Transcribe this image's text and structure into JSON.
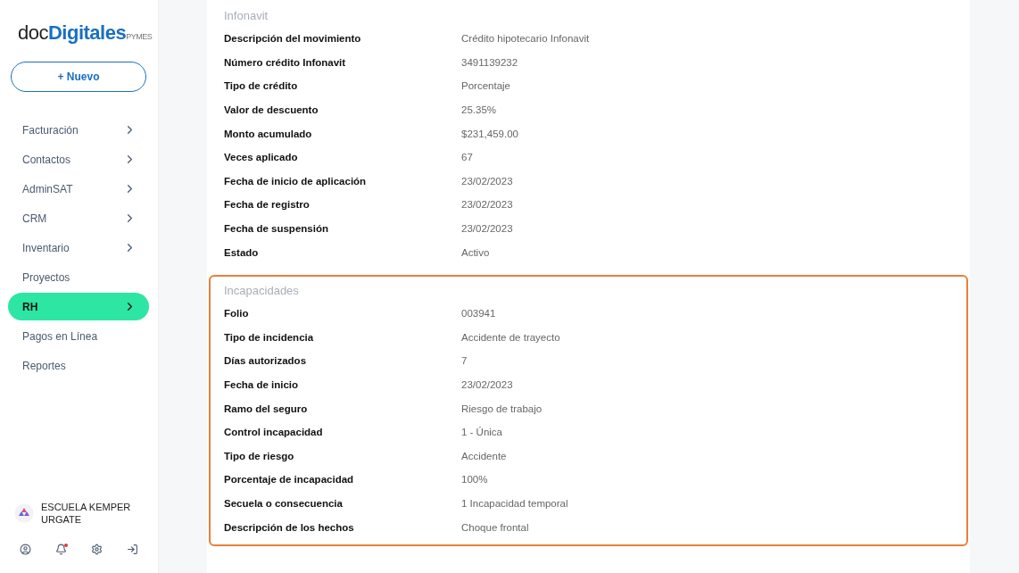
{
  "sidebar": {
    "logo": {
      "main": "doc",
      "accent": "Digitales",
      "suffix": "PYMES"
    },
    "new_button": "+ Nuevo",
    "items": [
      {
        "label": "Facturación",
        "has_children": true,
        "selected": false
      },
      {
        "label": "Contactos",
        "has_children": true,
        "selected": false
      },
      {
        "label": "AdminSAT",
        "has_children": true,
        "selected": false
      },
      {
        "label": "CRM",
        "has_children": true,
        "selected": false
      },
      {
        "label": "Inventario",
        "has_children": true,
        "selected": false
      },
      {
        "label": "Proyectos",
        "has_children": false,
        "selected": false
      },
      {
        "label": "RH",
        "has_children": true,
        "selected": true
      },
      {
        "label": "Pagos en Línea",
        "has_children": false,
        "selected": false
      },
      {
        "label": "Reportes",
        "has_children": false,
        "selected": false
      }
    ],
    "account": {
      "name": "ESCUELA KEMPER URGATE"
    },
    "notifications_unread": true
  },
  "sections": [
    {
      "title": "Infonavit",
      "highlighted": false,
      "rows": [
        {
          "label": "Descripción del movimiento",
          "value": "Crédito hipotecario Infonavit"
        },
        {
          "label": "Número crédito Infonavit",
          "value": "3491139232"
        },
        {
          "label": "Tipo de crédito",
          "value": "Porcentaje"
        },
        {
          "label": "Valor de descuento",
          "value": "25.35%"
        },
        {
          "label": "Monto acumulado",
          "value": "$231,459.00"
        },
        {
          "label": "Veces aplicado",
          "value": "67"
        },
        {
          "label": "Fecha de inicio de aplicación",
          "value": "23/02/2023"
        },
        {
          "label": "Fecha de registro",
          "value": "23/02/2023"
        },
        {
          "label": "Fecha de suspensión",
          "value": "23/02/2023"
        },
        {
          "label": "Estado",
          "value": "Activo"
        }
      ]
    },
    {
      "title": "Incapacidades",
      "highlighted": true,
      "rows": [
        {
          "label": "Folio",
          "value": "003941"
        },
        {
          "label": "Tipo de incidencia",
          "value": "Accidente de trayecto"
        },
        {
          "label": "Días autorizados",
          "value": "7"
        },
        {
          "label": "Fecha de inicio",
          "value": "23/02/2023"
        },
        {
          "label": "Ramo del seguro",
          "value": "Riesgo de trabajo"
        },
        {
          "label": "Control incapacidad",
          "value": "1 - Única"
        },
        {
          "label": "Tipo de riesgo",
          "value": "Accidente"
        },
        {
          "label": "Porcentaje de incapacidad",
          "value": "100%"
        },
        {
          "label": "Secuela o consecuencia",
          "value": "1 Incapacidad temporal"
        },
        {
          "label": "Descripción de los hechos",
          "value": "Choque frontal"
        }
      ]
    }
  ]
}
